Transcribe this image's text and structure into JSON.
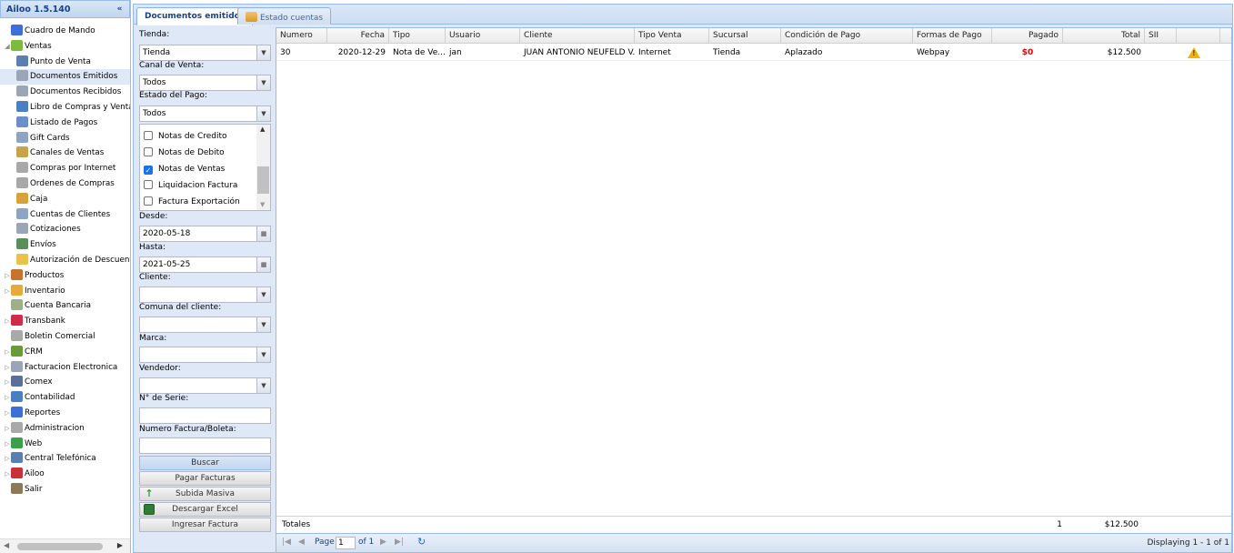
{
  "app": {
    "title": "Ailoo 1.5.140",
    "collapse_icon": "«"
  },
  "nav": {
    "items": [
      {
        "label": "Cuadro de Mando",
        "icon": "chart-icon",
        "color": "#3f6fd6",
        "level": 0,
        "expander": ""
      },
      {
        "label": "Ventas",
        "icon": "tag-icon",
        "color": "#7dbb3f",
        "level": 0,
        "expander": "◢"
      },
      {
        "label": "Punto de Venta",
        "icon": "register-icon",
        "color": "#5a7fb0",
        "level": 1,
        "expander": ""
      },
      {
        "label": "Documentos Emitidos",
        "icon": "document-icon",
        "color": "#9aa6b8",
        "level": 1,
        "expander": "",
        "selected": true
      },
      {
        "label": "Documentos Recibidos",
        "icon": "document-icon",
        "color": "#9aa6b8",
        "level": 1,
        "expander": ""
      },
      {
        "label": "Libro de Compras y Ventas",
        "icon": "book-icon",
        "color": "#4b7fc4",
        "level": 1,
        "expander": ""
      },
      {
        "label": "Listado de Pagos",
        "icon": "list-icon",
        "color": "#6b8fc8",
        "level": 1,
        "expander": ""
      },
      {
        "label": "Gift Cards",
        "icon": "card-icon",
        "color": "#8ea4c4",
        "level": 1,
        "expander": ""
      },
      {
        "label": "Canales de Ventas",
        "icon": "channel-icon",
        "color": "#c9a34a",
        "level": 1,
        "expander": ""
      },
      {
        "label": "Compras por Internet",
        "icon": "cart-icon",
        "color": "#a8a8a8",
        "level": 1,
        "expander": ""
      },
      {
        "label": "Ordenes de Compras",
        "icon": "cart-icon",
        "color": "#a8a8a8",
        "level": 1,
        "expander": ""
      },
      {
        "label": "Caja",
        "icon": "cashbox-icon",
        "color": "#d8a23a",
        "level": 1,
        "expander": ""
      },
      {
        "label": "Cuentas de Clientes",
        "icon": "card-icon",
        "color": "#8ea4c4",
        "level": 1,
        "expander": ""
      },
      {
        "label": "Cotizaciones",
        "icon": "document-icon",
        "color": "#9aa6b8",
        "level": 1,
        "expander": ""
      },
      {
        "label": "Envíos",
        "icon": "truck-icon",
        "color": "#5a8f5a",
        "level": 1,
        "expander": ""
      },
      {
        "label": "Autorización de Descuentos",
        "icon": "folder-icon",
        "color": "#e8c24a",
        "level": 1,
        "expander": ""
      },
      {
        "label": "Productos",
        "icon": "box-icon",
        "color": "#c7722f",
        "level": 0,
        "expander": "▷"
      },
      {
        "label": "Inventario",
        "icon": "inventory-icon",
        "color": "#e6a93a",
        "level": 0,
        "expander": "▷"
      },
      {
        "label": "Cuenta Bancaria",
        "icon": "bank-icon",
        "color": "#9db08a",
        "level": 0,
        "expander": ""
      },
      {
        "label": "Transbank",
        "icon": "transbank-icon",
        "color": "#d22b4a",
        "level": 0,
        "expander": "▷"
      },
      {
        "label": "Boletin Comercial",
        "icon": "tag-icon",
        "color": "#a9a9a9",
        "level": 0,
        "expander": ""
      },
      {
        "label": "CRM",
        "icon": "people-icon",
        "color": "#6a9a3a",
        "level": 0,
        "expander": "▷"
      },
      {
        "label": "Facturacion Electronica",
        "icon": "invoice-icon",
        "color": "#9aa6b8",
        "level": 0,
        "expander": "▷"
      },
      {
        "label": "Comex",
        "icon": "truck-icon",
        "color": "#5a6f9a",
        "level": 0,
        "expander": "▷"
      },
      {
        "label": "Contabilidad",
        "icon": "ledger-icon",
        "color": "#4b7fc4",
        "level": 0,
        "expander": "▷"
      },
      {
        "label": "Reportes",
        "icon": "chart-icon",
        "color": "#3f6fd6",
        "level": 0,
        "expander": "▷"
      },
      {
        "label": "Administracion",
        "icon": "gear-icon",
        "color": "#a9a9a9",
        "level": 0,
        "expander": "▷"
      },
      {
        "label": "Web",
        "icon": "globe-icon",
        "color": "#3aa04a",
        "level": 0,
        "expander": "▷"
      },
      {
        "label": "Central Telefónica",
        "icon": "phone-icon",
        "color": "#5a7fb0",
        "level": 0,
        "expander": "▷"
      },
      {
        "label": "Ailoo",
        "icon": "flower-icon",
        "color": "#c8303a",
        "level": 0,
        "expander": "▷"
      },
      {
        "label": "Salir",
        "icon": "exit-icon",
        "color": "#8a7a5a",
        "level": 0,
        "expander": ""
      }
    ]
  },
  "tabs": [
    {
      "label": "Documentos emitidos",
      "active": true
    },
    {
      "label": "Estado cuentas",
      "active": false,
      "icon": "account-icon"
    }
  ],
  "form": {
    "tienda": {
      "label": "Tienda:",
      "value": "Tienda"
    },
    "canal": {
      "label": "Canal de Venta:",
      "value": "Todos"
    },
    "estado": {
      "label": "Estado del Pago:",
      "value": "Todos"
    },
    "tipos": [
      {
        "label": "Notas de Credito",
        "checked": false
      },
      {
        "label": "Notas de Debito",
        "checked": false
      },
      {
        "label": "Notas de Ventas",
        "checked": true
      },
      {
        "label": "Liquidacion Factura",
        "checked": false
      },
      {
        "label": "Factura Exportación",
        "checked": false
      }
    ],
    "desde": {
      "label": "Desde:",
      "value": "2020-05-18"
    },
    "hasta": {
      "label": "Hasta:",
      "value": "2021-05-25"
    },
    "cliente": {
      "label": "Cliente:",
      "value": ""
    },
    "comuna": {
      "label": "Comuna del cliente:",
      "value": ""
    },
    "marca": {
      "label": "Marca:",
      "value": ""
    },
    "vendedor": {
      "label": "Vendedor:",
      "value": ""
    },
    "serie": {
      "label": "N° de Serie:",
      "value": ""
    },
    "factura": {
      "label": "Numero Factura/Boleta:",
      "value": ""
    },
    "buttons": {
      "buscar": "Buscar",
      "pagar": "Pagar Facturas",
      "subida": "Subida Masiva",
      "descargar": "Descargar Excel",
      "ingresar": "Ingresar Factura"
    }
  },
  "grid": {
    "columns": [
      "Numero",
      "Fecha",
      "Tipo",
      "Usuario",
      "Cliente",
      "Tipo Venta",
      "Sucursal",
      "Condición de Pago",
      "Formas de Pago",
      "Pagado",
      "Total",
      "SII"
    ],
    "rows": [
      {
        "numero": "30",
        "fecha": "2020-12-29",
        "tipo": "Nota de Ve...",
        "usuario": "jan",
        "cliente": "JUAN ANTONIO NEUFELD V...",
        "tipo_venta": "Internet",
        "sucursal": "Tienda",
        "condicion": "Aplazado",
        "formas": "Webpay",
        "pagado": "$0",
        "total": "$12.500",
        "sii": "",
        "status_icon": "warning-icon"
      }
    ],
    "totals": {
      "label": "Totales",
      "count": "1",
      "total": "$12.500"
    },
    "pager": {
      "page_label": "Page",
      "page_value": "1",
      "of_label": "of 1",
      "displaying": "Displaying 1 - 1 of 1"
    }
  }
}
